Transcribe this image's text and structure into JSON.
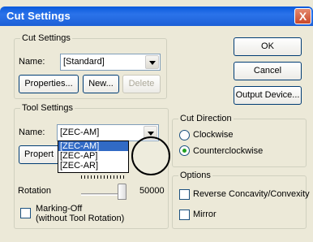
{
  "window": {
    "title": "Cut Settings",
    "close_glyph": "X"
  },
  "cut_settings": {
    "legend": "Cut Settings",
    "name_label": "Name:",
    "name_value": "[Standard]",
    "properties_button": "Properties...",
    "new_button": "New...",
    "delete_button": "Delete"
  },
  "dialog_buttons": {
    "ok": "OK",
    "cancel": "Cancel",
    "output_device": "Output Device..."
  },
  "tool_settings": {
    "legend": "Tool Settings",
    "name_label": "Name:",
    "name_value": "[ZEC-AM]",
    "properties_partial": "Propert",
    "dropdown_options": [
      "[ZEC-AM]",
      "[ZEC-AP]",
      "[ZEC-AR]"
    ],
    "selected_option": "[ZEC-AM]",
    "rotation_label": "Rotation",
    "rotation_value": "50000",
    "rotation_slider_fraction": 1.0,
    "marking_off_line1": "Marking-Off",
    "marking_off_line2": "(without Tool Rotation)",
    "marking_off_checked": false
  },
  "cut_direction": {
    "legend": "Cut Direction",
    "clockwise_label": "Clockwise",
    "counterclockwise_label": "Counterclockwise",
    "selected": "Counterclockwise"
  },
  "options": {
    "legend": "Options",
    "reverse_label": "Reverse Concavity/Convexity",
    "reverse_checked": false,
    "mirror_label": "Mirror",
    "mirror_checked": false
  },
  "colors": {
    "titlebar": "#0a5adc",
    "dialog_bg": "#ece9d8",
    "selection": "#316ac5"
  }
}
